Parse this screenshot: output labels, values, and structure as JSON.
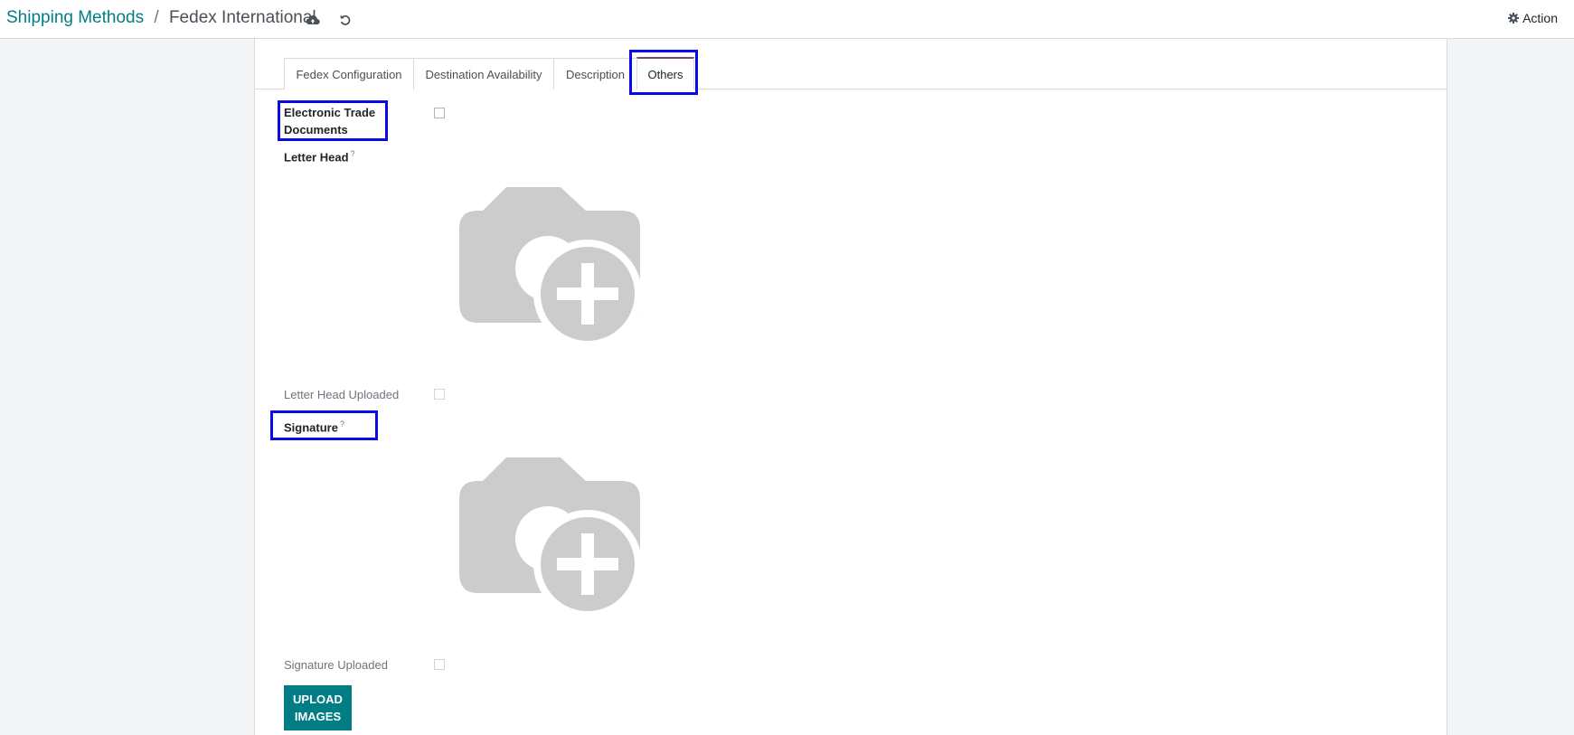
{
  "breadcrumb": {
    "parent": "Shipping Methods",
    "separator": "/",
    "current": "Fedex International"
  },
  "header": {
    "save_icon": "cloud-upload-icon",
    "discard_icon": "undo-icon",
    "action_label": "Action",
    "action_icon": "gear-icon"
  },
  "tabs": [
    {
      "label": "Fedex Configuration",
      "active": false
    },
    {
      "label": "Destination Availability",
      "active": false
    },
    {
      "label": "Description",
      "active": false
    },
    {
      "label": "Others",
      "active": true
    }
  ],
  "fields": {
    "electronic_trade_documents": {
      "label_line1": "Electronic Trade",
      "label_line2": "Documents",
      "checked": false
    },
    "letter_head": {
      "label": "Letter Head",
      "help": "?"
    },
    "letter_head_uploaded": {
      "label": "Letter Head Uploaded",
      "checked": false
    },
    "signature": {
      "label": "Signature",
      "help": "?"
    },
    "signature_uploaded": {
      "label": "Signature Uploaded",
      "checked": false
    }
  },
  "upload_button": {
    "line1": "UPLOAD",
    "line2": "IMAGES"
  },
  "colors": {
    "accent": "#017e84",
    "highlight": "#0a0ae6",
    "placeholder": "#cccccc"
  }
}
